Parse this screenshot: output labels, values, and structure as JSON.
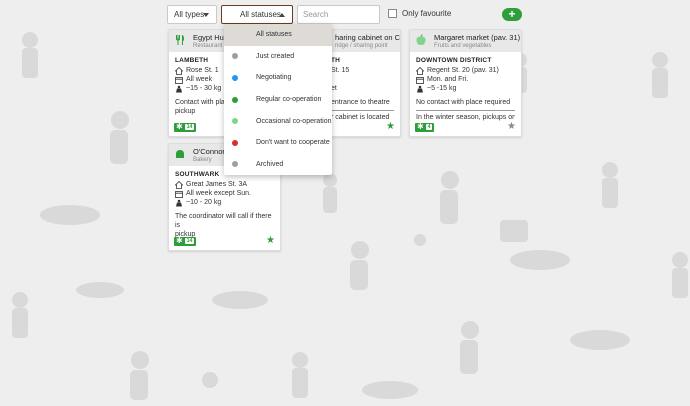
{
  "filters": {
    "type_select": "All types",
    "status_select": "All statuses",
    "search_placeholder": "Search",
    "only_favourite_label": "Only favourite",
    "add_label": "+"
  },
  "status_dropdown": {
    "items": [
      {
        "label": "All statuses",
        "color": ""
      },
      {
        "label": "Just created",
        "color": "#9e9e9e"
      },
      {
        "label": "Negotiating",
        "color": "#2196f3"
      },
      {
        "label": "Regular co-operation",
        "color": "#2e9e3a"
      },
      {
        "label": "Occasional co-operation",
        "color": "#7fd68a"
      },
      {
        "label": "Don't want to cooperate",
        "color": "#d32f2f"
      },
      {
        "label": "Archived",
        "color": "#9e9e9e"
      }
    ]
  },
  "cards": [
    {
      "title": "Egypt Hum",
      "subtitle": "Restaurant",
      "district": "LAMBETH",
      "address": "Rose St. 1",
      "schedule": "All week",
      "amount": "~15 - 30 kg",
      "note": "Contact with plac",
      "note2": "pickup",
      "count": "14",
      "favourite": true
    },
    {
      "title": "haring cabinet on Ca...",
      "subtitle": "ridge / sharing point",
      "district": "TH",
      "address": "St. 15",
      "schedule": "",
      "amount": "et",
      "note": "entrance to theatre",
      "note2": "r cabinet is located",
      "count": "",
      "favourite": true
    },
    {
      "title": "Margaret market (pav. 31)",
      "subtitle": "Fruits and vegetables",
      "district": "DOWNTOWN DISTRICT",
      "address": "Regent St. 20 (pav. 31)",
      "schedule": "Mon. and Fri.",
      "amount": "~5 -15 kg",
      "note": "No contact with place required",
      "note2": "In the winter season, pickups on",
      "count": "4",
      "favourite": false
    },
    {
      "title": "O'Connors",
      "subtitle": "Bakery",
      "district": "SOUTHWARK",
      "address": "Great James St. 3A",
      "schedule": "All week except Sun.",
      "amount": "~10 - 20 kg",
      "note": "The coordinator will call if there is",
      "note2": "pickup",
      "count": "14",
      "favourite": true
    }
  ],
  "colors": {
    "accent_green": "#2e9e3a",
    "active_border": "#6b3b1f",
    "background": "#eeeeee"
  }
}
